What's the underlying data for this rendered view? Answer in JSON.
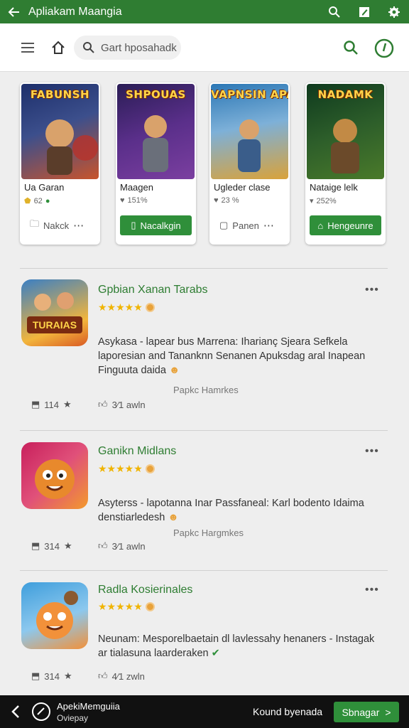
{
  "appbar": {
    "title": "Apliakam Maangia",
    "icons": [
      "back-arrow-icon",
      "search-icon",
      "edit-icon",
      "settings-icon"
    ]
  },
  "toolbar": {
    "search_placeholder": "Gart hposahadk"
  },
  "cards": [
    {
      "art_title": "FABUNSH",
      "name": "Ua Garan",
      "stat": "62",
      "button": "Nakck",
      "button_style": "plain",
      "colors": [
        "#1d2f6b",
        "#c8542b"
      ]
    },
    {
      "art_title": "SHPOUAS",
      "name": "Maagen",
      "stat": "151%",
      "button": "Nacalkgin",
      "button_style": "green",
      "colors": [
        "#2a1d55",
        "#7b3fa0"
      ]
    },
    {
      "art_title": "VAPNSIN APARES",
      "name": "Ugleder clase",
      "stat": "23 %",
      "button": "Panen",
      "button_style": "plain",
      "colors": [
        "#2b77b5",
        "#d9a23a"
      ]
    },
    {
      "art_title": "NADAMK",
      "name": "Nataige lelk",
      "stat": "252%",
      "button": "Hengeunre",
      "button_style": "green",
      "colors": [
        "#0f3a1e",
        "#4a7a2a"
      ]
    }
  ],
  "list": [
    {
      "title": "Gpbian Xanan Tarabs",
      "stars": "★★★★★",
      "desc": "Asykasa - lapear bus Marrena: Iharianç Sjeara Sefkela laporesian and Tananknn Senanen Apuksdag aral Inapean Finguuta daida",
      "note": "Papkc Hamrkes",
      "meta1": "114",
      "meta2": "3⁄1 awln",
      "thumb_label": "TURAIAS",
      "colors": [
        "#d95a24",
        "#f2b53c"
      ]
    },
    {
      "title": "Ganikn Midlans",
      "stars": "★★★★★",
      "desc": "Asyterss - lapotanna Inar Passfaneal: Karl bodento Idaima denstiarledesh",
      "note": "Papkc Hargmkes",
      "meta1": "314",
      "meta2": "3⁄1 awln",
      "thumb_label": "",
      "colors": [
        "#c8205c",
        "#f39a2c"
      ]
    },
    {
      "title": "Radla Kosierinales",
      "stars": "★★★★★",
      "desc": "Neunam: Mesporelbaetain dl lavlessahy henaners - Instagak ar tialasuna laarderaken",
      "note": "",
      "meta1": "314",
      "meta2": "4⁄1 zwln",
      "thumb_label": "",
      "colors": [
        "#3f9edc",
        "#f2913a"
      ]
    }
  ],
  "bottombar": {
    "line1": "ApekiMemguiia",
    "line2": "Oviepay",
    "text": "Kound byenada",
    "button": "Sbnagar"
  }
}
